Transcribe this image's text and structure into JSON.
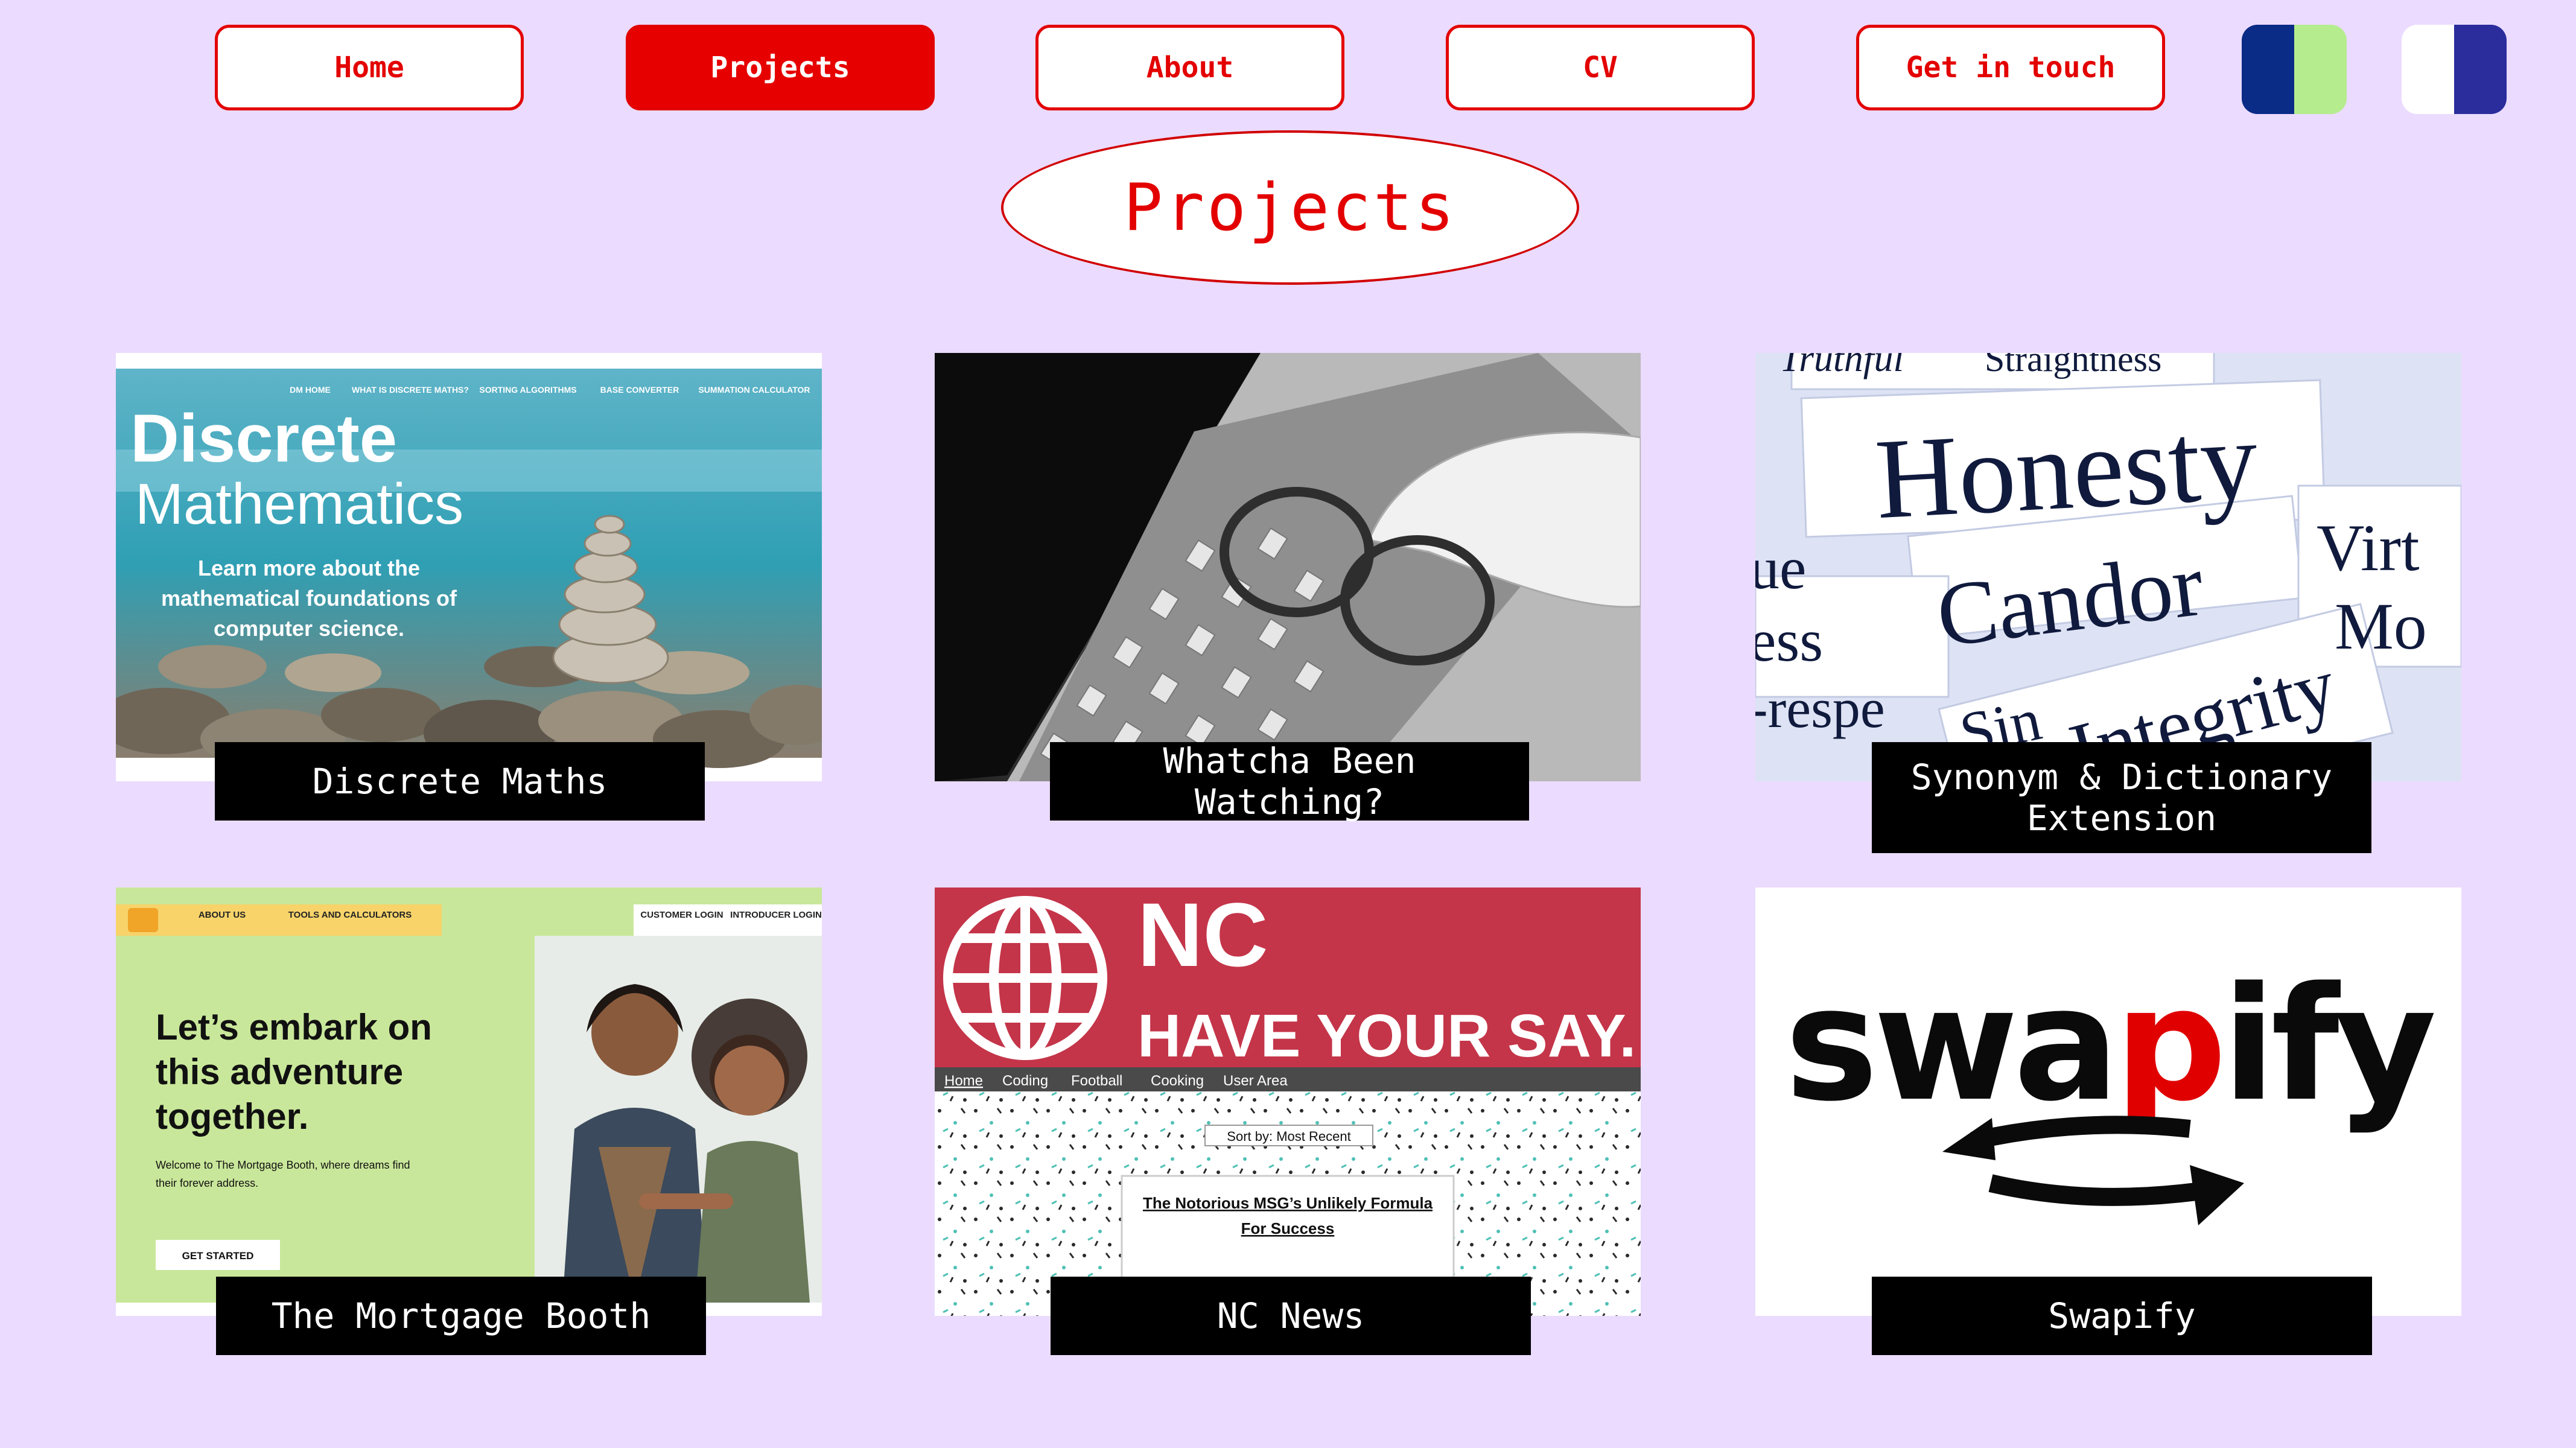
{
  "nav": {
    "home": "Home",
    "projects": "Projects",
    "about": "About",
    "cv": "CV",
    "contact": "Get in touch"
  },
  "theme_toggles": [
    {
      "icon": "theme-blue-green-icon",
      "colors": [
        "#0a2b86",
        "#b5ec8e"
      ]
    },
    {
      "icon": "theme-white-indigo-icon",
      "colors": [
        "#ffffff",
        "#2a2d9b"
      ]
    }
  ],
  "page_title": "Projects",
  "colors": {
    "accent": "#e30000",
    "background": "#ebdbff",
    "caption_bg": "#000000"
  },
  "projects": [
    {
      "caption": "Discrete Maths",
      "thumb": {
        "nav": [
          "DM HOME",
          "WHAT IS DISCRETE MATHS?",
          "SORTING ALGORITHMS",
          "BASE CONVERTER",
          "SUMMATION CALCULATOR"
        ],
        "title_line1": "Discrete",
        "title_line2": "Mathematics",
        "body_line1": "Learn more about the",
        "body_line2": "mathematical foundations of",
        "body_line3": "computer science."
      }
    },
    {
      "caption": "Whatcha Been Watching?",
      "thumb": {}
    },
    {
      "caption_line1": "Synonym & Dictionary",
      "caption_line2": "Extension",
      "thumb": {
        "words": [
          "Truthful",
          "Straightness",
          "Honesty",
          "Candor",
          "Virt",
          "Mo",
          "Sin",
          "Integrity",
          "-respe",
          "ess",
          "ue"
        ]
      }
    },
    {
      "caption": "The Mortgage Booth",
      "thumb": {
        "nav": [
          "ABOUT US",
          "TOOLS AND CALCULATORS",
          "CUSTOMER LOGIN",
          "INTRODUCER LOGIN"
        ],
        "headline1": "Let’s embark on",
        "headline2": "this adventure",
        "headline3": "together.",
        "body1": "Welcome to The Mortgage Booth, where dreams find",
        "body2": "their forever address.",
        "cta": "GET STARTED"
      }
    },
    {
      "caption": "NC News",
      "thumb": {
        "brand": "NC",
        "tagline": "HAVE YOUR SAY.",
        "nav": [
          "Home",
          "Coding",
          "Football",
          "Cooking",
          "User Area"
        ],
        "sort": "Sort by: Most Recent",
        "article1": "The Notorious MSG’s Unlikely Formula",
        "article2": "For Success"
      }
    },
    {
      "caption": "Swapify",
      "thumb": {
        "logo_start": "swa",
        "logo_mid": "p",
        "logo_end": "ify"
      }
    }
  ]
}
